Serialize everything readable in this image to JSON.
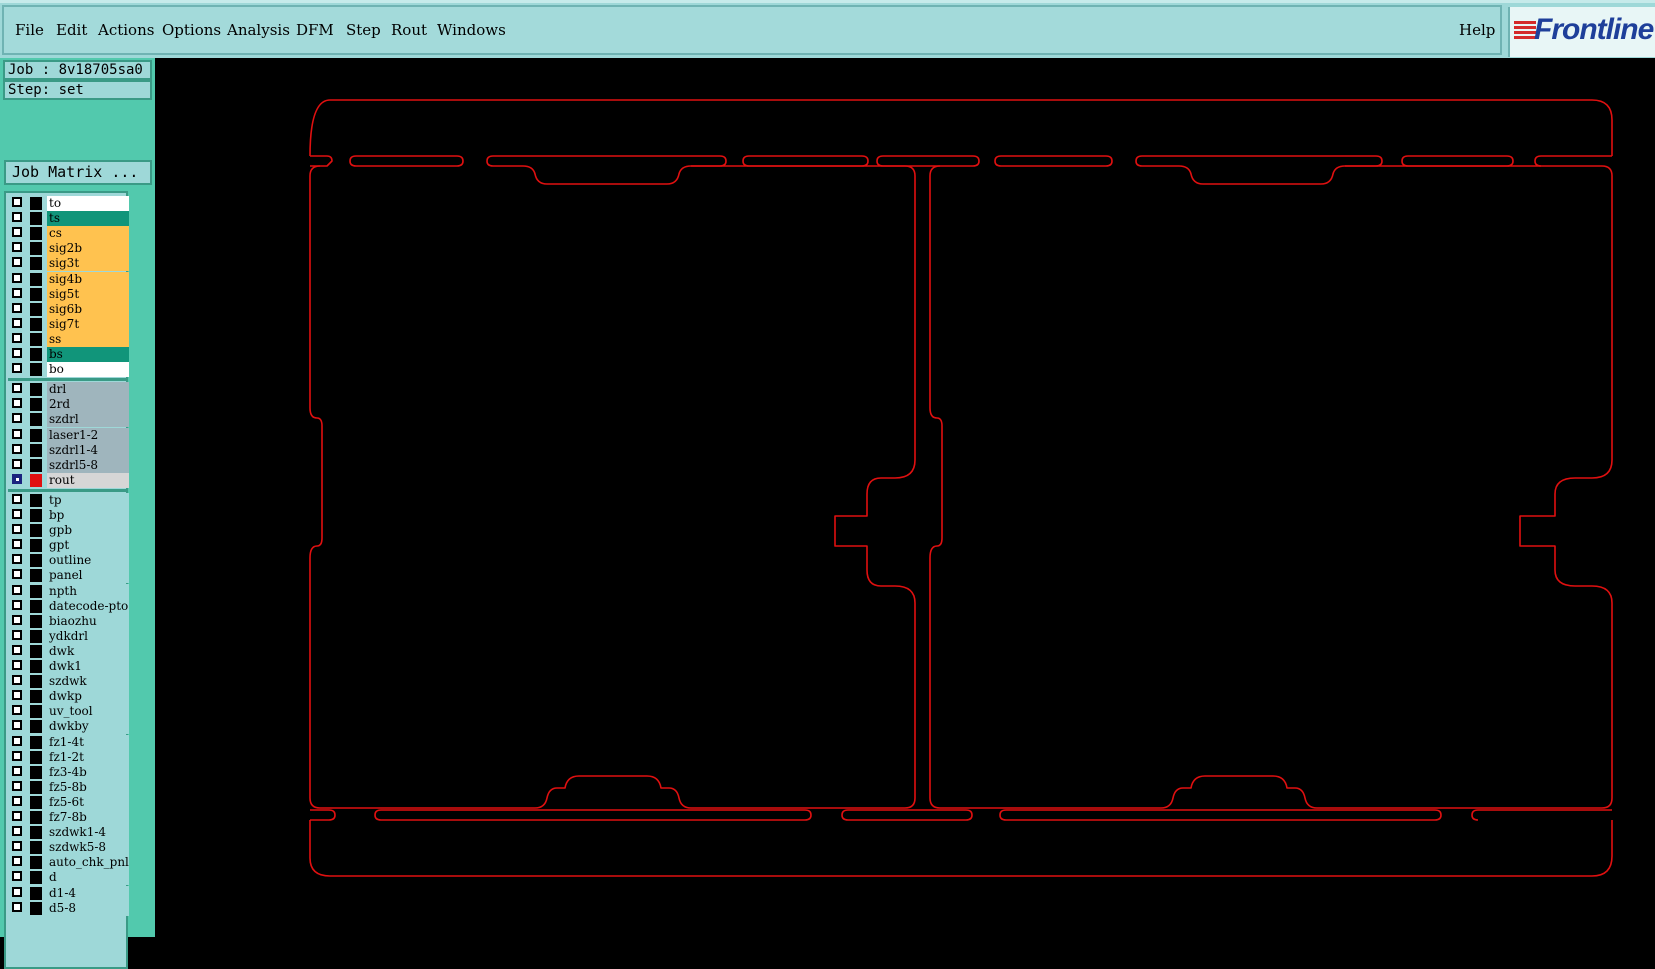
{
  "menu": {
    "items": [
      "File",
      "Edit",
      "Actions",
      "Options",
      "Analysis",
      "DFM",
      "Step",
      "Rout",
      "Windows"
    ],
    "help": "Help",
    "logo_text": "Frontline"
  },
  "info": {
    "job": "Job : 8v18705sa0",
    "step": "Step: set",
    "job_matrix": "Job Matrix ..."
  },
  "colors": {
    "panel_bg": "#9ed8d8",
    "side_bg": "#52c9ad",
    "signal_layer": "#ffc24f",
    "mask_layer": "#11957a",
    "drill_layer": "#9fb5bd",
    "misc_layer": "#9ed8d8",
    "rout_outline": "#e01010"
  },
  "layers": [
    {
      "name": "to",
      "color": "#ffffff",
      "group": 1
    },
    {
      "name": "ts",
      "color": "#11957a",
      "group": 1
    },
    {
      "name": "cs",
      "color": "#ffc24f",
      "group": 1
    },
    {
      "name": "sig2b",
      "color": "#ffc24f",
      "group": 1
    },
    {
      "name": "sig3t",
      "color": "#ffc24f",
      "group": 1
    },
    {
      "name": "sig4b",
      "color": "#ffc24f",
      "group": 1
    },
    {
      "name": "sig5t",
      "color": "#ffc24f",
      "group": 1
    },
    {
      "name": "sig6b",
      "color": "#ffc24f",
      "group": 1
    },
    {
      "name": "sig7t",
      "color": "#ffc24f",
      "group": 1
    },
    {
      "name": "ss",
      "color": "#ffc24f",
      "group": 1
    },
    {
      "name": "bs",
      "color": "#11957a",
      "group": 1
    },
    {
      "name": "bo",
      "color": "#ffffff",
      "group": 1
    },
    {
      "name": "drl",
      "color": "#9fb5bd",
      "group": 2
    },
    {
      "name": "2rd",
      "color": "#9fb5bd",
      "group": 2
    },
    {
      "name": "szdrl",
      "color": "#9fb5bd",
      "group": 2
    },
    {
      "name": "laser1-2",
      "color": "#9fb5bd",
      "group": 2
    },
    {
      "name": "szdrl1-4",
      "color": "#9fb5bd",
      "group": 2
    },
    {
      "name": "szdrl5-8",
      "color": "#9fb5bd",
      "group": 2
    },
    {
      "name": "rout",
      "color": "#d6d6d6",
      "group": 2,
      "active": true
    },
    {
      "name": "tp",
      "color": "#9ed8d8",
      "group": 3
    },
    {
      "name": "bp",
      "color": "#9ed8d8",
      "group": 3
    },
    {
      "name": "gpb",
      "color": "#9ed8d8",
      "group": 3
    },
    {
      "name": "gpt",
      "color": "#9ed8d8",
      "group": 3
    },
    {
      "name": "outline",
      "color": "#9ed8d8",
      "group": 3
    },
    {
      "name": "panel",
      "color": "#9ed8d8",
      "group": 3
    },
    {
      "name": "npth",
      "color": "#9ed8d8",
      "group": 3
    },
    {
      "name": "datecode-pto",
      "color": "#9ed8d8",
      "group": 3
    },
    {
      "name": "biaozhu",
      "color": "#9ed8d8",
      "group": 3
    },
    {
      "name": "ydkdrl",
      "color": "#9ed8d8",
      "group": 3
    },
    {
      "name": "dwk",
      "color": "#9ed8d8",
      "group": 3
    },
    {
      "name": "dwk1",
      "color": "#9ed8d8",
      "group": 3
    },
    {
      "name": "szdwk",
      "color": "#9ed8d8",
      "group": 3
    },
    {
      "name": "dwkp",
      "color": "#9ed8d8",
      "group": 3
    },
    {
      "name": "uv_tool",
      "color": "#9ed8d8",
      "group": 3
    },
    {
      "name": "dwkby",
      "color": "#9ed8d8",
      "group": 3
    },
    {
      "name": "fz1-4t",
      "color": "#9ed8d8",
      "group": 3
    },
    {
      "name": "fz1-2t",
      "color": "#9ed8d8",
      "group": 3
    },
    {
      "name": "fz3-4b",
      "color": "#9ed8d8",
      "group": 3
    },
    {
      "name": "fz5-8b",
      "color": "#9ed8d8",
      "group": 3
    },
    {
      "name": "fz5-6t",
      "color": "#9ed8d8",
      "group": 3
    },
    {
      "name": "fz7-8b",
      "color": "#9ed8d8",
      "group": 3
    },
    {
      "name": "szdwk1-4",
      "color": "#9ed8d8",
      "group": 3
    },
    {
      "name": "szdwk5-8",
      "color": "#9ed8d8",
      "group": 3
    },
    {
      "name": "auto_chk_pnl",
      "color": "#9ed8d8",
      "group": 3
    },
    {
      "name": "d",
      "color": "#9ed8d8",
      "group": 3
    },
    {
      "name": "d1-4",
      "color": "#9ed8d8",
      "group": 3
    },
    {
      "name": "d5-8",
      "color": "#9ed8d8",
      "group": 3
    }
  ]
}
